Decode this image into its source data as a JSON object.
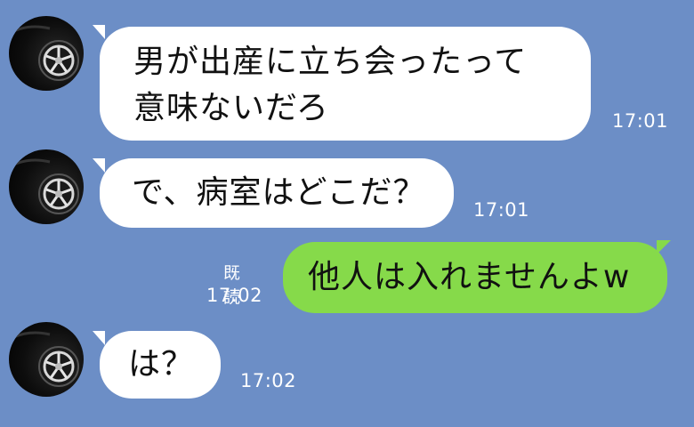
{
  "messages": [
    {
      "sender": "other",
      "lines": [
        "男が出産に立ち会ったって",
        "意味ないだろ"
      ],
      "time": "17:01"
    },
    {
      "sender": "other",
      "lines": [
        "で、病室はどこだ？"
      ],
      "time": "17:01"
    },
    {
      "sender": "me",
      "lines": [
        "他人は入れませんよw"
      ],
      "time": "17:02",
      "read_label": "既読"
    },
    {
      "sender": "other",
      "lines": [
        "は？"
      ],
      "time": "17:02"
    }
  ],
  "colors": {
    "background": "#6c8ec6",
    "incoming_bubble": "#ffffff",
    "outgoing_bubble": "#86da4a",
    "meta_text": "#ffffff"
  },
  "avatar_icon": "car-wheel-icon"
}
